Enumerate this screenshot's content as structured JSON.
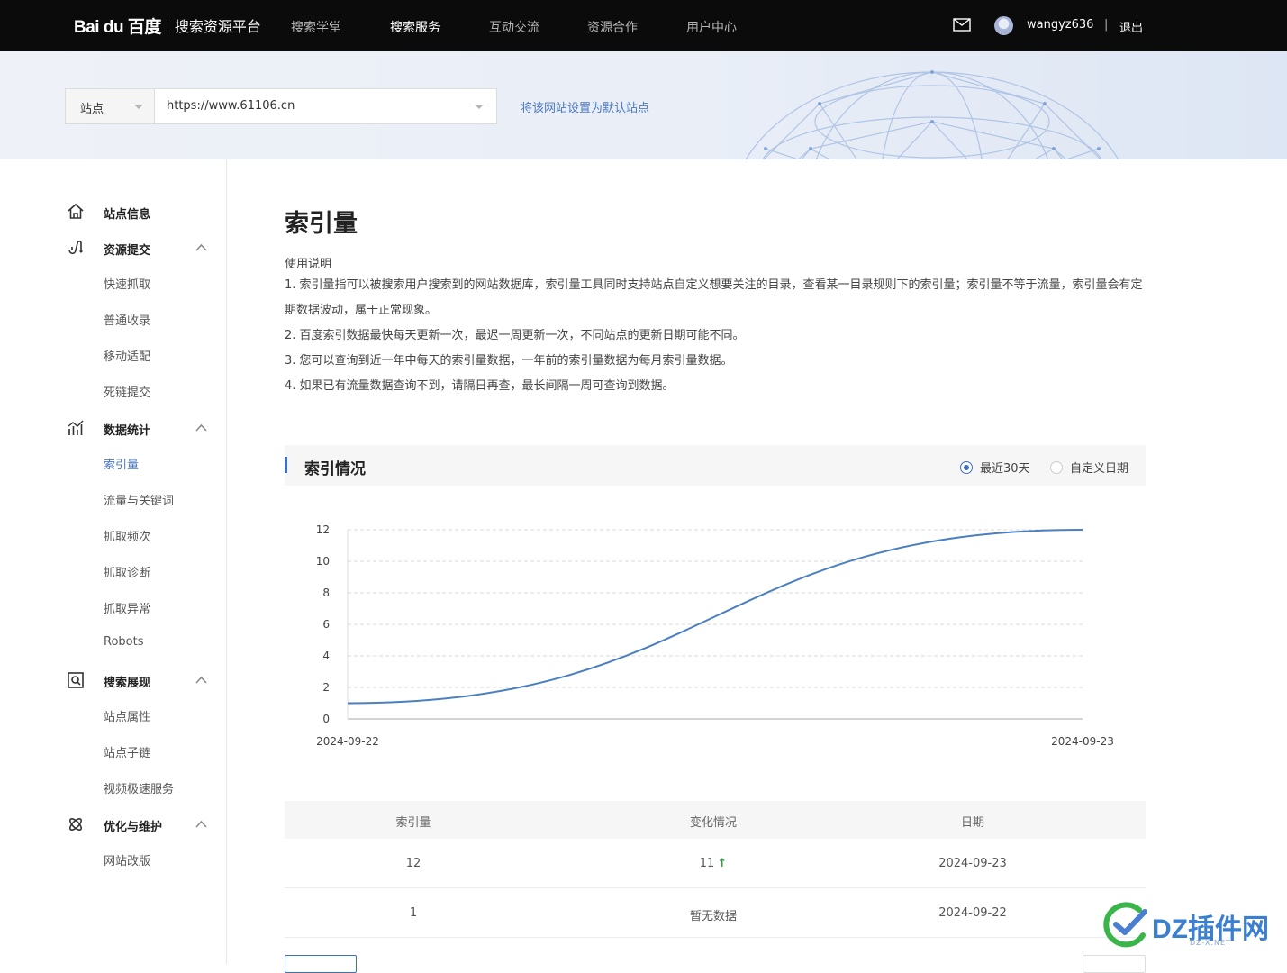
{
  "header": {
    "logo_mark": "Bai du 百度",
    "logo_text": "搜索资源平台",
    "nav": [
      "搜索学堂",
      "搜索服务",
      "互动交流",
      "资源合作",
      "用户中心"
    ],
    "active_nav": "搜索服务",
    "username": "wangyz636",
    "divider": "|",
    "logout": "退出"
  },
  "site_bar": {
    "type_label": "站点",
    "site_url": "https://www.61106.cn",
    "set_default": "将该网站设置为默认站点"
  },
  "sidebar": {
    "sections": [
      {
        "label": "站点信息",
        "icon": "home-icon",
        "items": []
      },
      {
        "label": "资源提交",
        "icon": "submit-icon",
        "items": [
          "快速抓取",
          "普通收录",
          "移动适配",
          "死链提交"
        ]
      },
      {
        "label": "数据统计",
        "icon": "stats-icon",
        "items": [
          "索引量",
          "流量与关键词",
          "抓取频次",
          "抓取诊断",
          "抓取异常",
          "Robots"
        ]
      },
      {
        "label": "搜索展现",
        "icon": "search-display-icon",
        "items": [
          "站点属性",
          "站点子链",
          "视频极速服务"
        ]
      },
      {
        "label": "优化与维护",
        "icon": "optimize-icon",
        "items": [
          "网站改版"
        ]
      }
    ],
    "active_item": "索引量"
  },
  "main": {
    "title": "索引量",
    "usage_title": "使用说明",
    "usage_lines": [
      "1. 索引量指可以被搜索用户搜索到的网站数据库，索引量工具同时支持站点自定义想要关注的目录，查看某一目录规则下的索引量；索引量不等于流量，索引量会有定期数据波动，属于正常现象。",
      "2. 百度索引数据最快每天更新一次，最迟一周更新一次，不同站点的更新日期可能不同。",
      "3. 您可以查询到近一年中每天的索引量数据，一年前的索引量数据为每月索引量数据。",
      "4. 如果已有流量数据查询不到，请隔日再查，最长间隔一周可查询到数据。"
    ],
    "panel_title": "索引情况",
    "radio_recent": "最近30天",
    "radio_custom": "自定义日期",
    "table": {
      "headers": [
        "索引量",
        "变化情况",
        "日期"
      ],
      "rows": [
        {
          "count": "12",
          "change": "11",
          "change_dir": "up",
          "date": "2024-09-23"
        },
        {
          "count": "1",
          "change": "暂无数据",
          "change_dir": "",
          "date": "2024-09-22"
        }
      ]
    }
  },
  "chart_data": {
    "type": "line",
    "x": [
      "2024-09-22",
      "2024-09-23"
    ],
    "series": [
      {
        "values": [
          1,
          12
        ]
      }
    ],
    "ylim": [
      0,
      12
    ],
    "yticks": [
      0,
      2,
      4,
      6,
      8,
      10,
      12
    ],
    "grid": true,
    "color": "#4a7fc1"
  },
  "watermark": {
    "text": "DZ插件网",
    "sub": "DZ-X.NET"
  }
}
